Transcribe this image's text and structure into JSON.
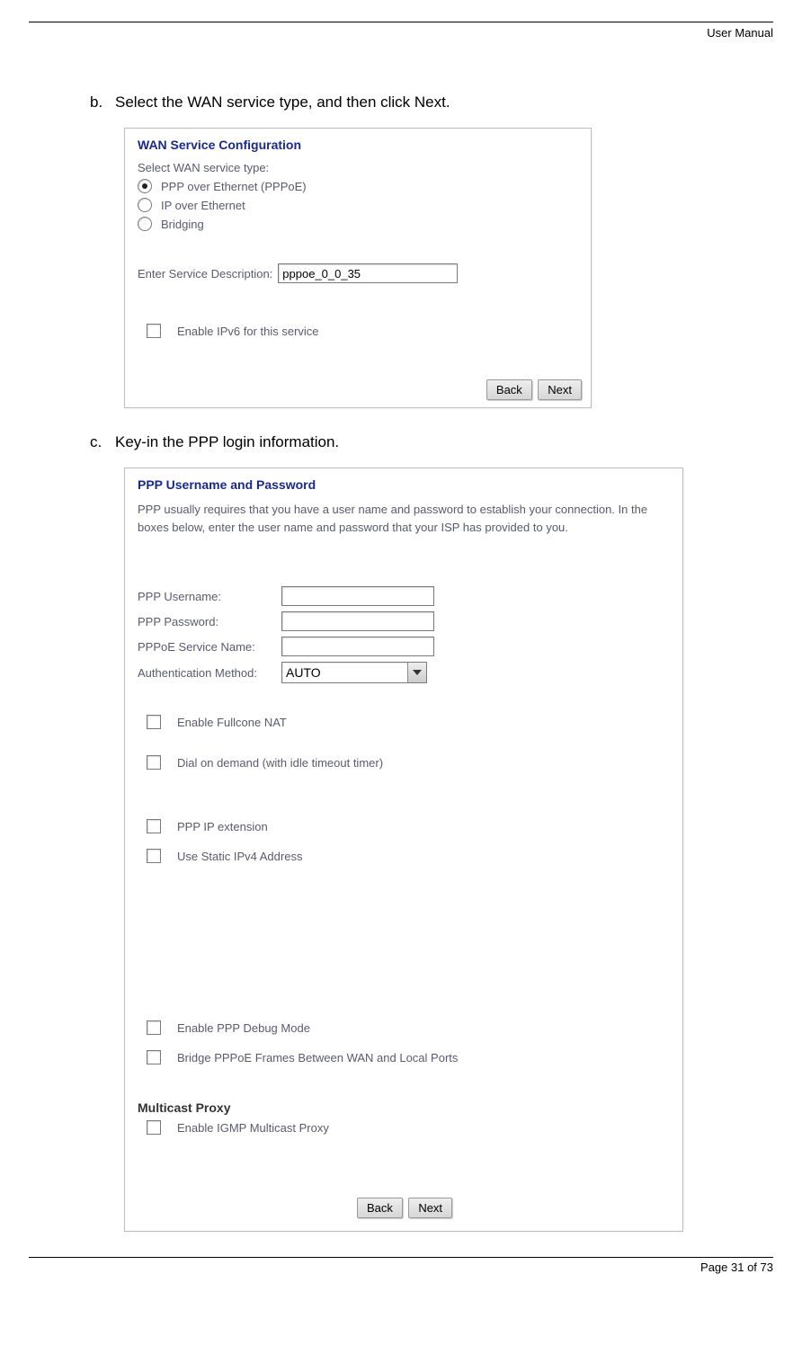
{
  "header": {
    "right": "User Manual"
  },
  "steps": {
    "b": {
      "letter": "b.",
      "text": "Select the WAN service type, and then click Next."
    },
    "c": {
      "letter": "c.",
      "text": "Key-in the PPP login information."
    }
  },
  "panel1": {
    "title": "WAN Service Configuration",
    "select_label": "Select WAN service type:",
    "options": {
      "pppoe": "PPP over Ethernet (PPPoE)",
      "ipoe": "IP over Ethernet",
      "bridging": "Bridging"
    },
    "desc_label": "Enter Service Description:",
    "desc_value": "pppoe_0_0_35",
    "ipv6_label": "Enable IPv6 for this service",
    "back": "Back",
    "next": "Next"
  },
  "panel2": {
    "title": "PPP Username and Password",
    "intro": "PPP usually requires that you have a user name and password to establish your connection. In the boxes below, enter the user name and password that your ISP has provided to you.",
    "username_label": "PPP Username:",
    "password_label": "PPP Password:",
    "service_label": "PPPoE Service Name:",
    "auth_label": "Authentication Method:",
    "auth_value": "AUTO",
    "checks": {
      "fullcone": "Enable Fullcone NAT",
      "dial": "Dial on demand (with idle timeout timer)",
      "pppip": "PPP IP extension",
      "static": "Use Static IPv4 Address",
      "debug": "Enable PPP Debug Mode",
      "bridge": "Bridge PPPoE Frames Between WAN and Local Ports",
      "igmp": "Enable IGMP Multicast Proxy"
    },
    "multicast_title": "Multicast Proxy",
    "back": "Back",
    "next": "Next"
  },
  "footer": {
    "page": "Page 31 of 73"
  }
}
